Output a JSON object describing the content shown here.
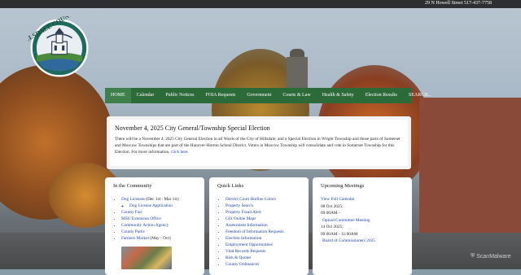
{
  "topbar": {
    "address": "29 N Howell Street 517-437-7758"
  },
  "logo": {
    "text": "HILLSDALE COUNTY"
  },
  "nav": {
    "items": [
      "HOME",
      "Calendar",
      "Public Notices",
      "FOIA Requests",
      "Government",
      "Courts & Law",
      "Health & Safety",
      "Election Results",
      "SEARCH..."
    ]
  },
  "notice": {
    "title": "November 4, 2025 City General/Township Special Election",
    "body": "There will be a November 4, 2025 City General Election in all Wards of the City of Hillsdale; and a Special Election in Wright Township and those parts of Somerset and Moscow Townships that are part of the Hanover-Horton School District. Voters in Moscow Township will consolidate and vote in Somerset Township for this Election. For more information,",
    "link": "click here."
  },
  "community": {
    "title": "In the Community",
    "items": [
      {
        "link": "Dog Licenses",
        "extra": " (Dec 1st - Mar 1st)"
      },
      {
        "link": "County Fair",
        "extra": ""
      },
      {
        "link": "MSU Extension Office",
        "extra": ""
      },
      {
        "link": "Community Action Agency",
        "extra": ""
      },
      {
        "link": "County Parks",
        "extra": ""
      },
      {
        "link": "Farmers Market",
        "extra": " (May - Oct)"
      }
    ],
    "sub_item": "Dog License Application"
  },
  "quick_links": {
    "title": "Quick Links",
    "items": [
      "District Court Hotline Colors",
      "Property Search",
      "Property Fraud Alert",
      "GIS Online Maps",
      "Assessment Information",
      "Freedom of Information Requests",
      "Election Information",
      "Employment Opportunities",
      "Vital Records Requests",
      "Bids & Quotes",
      "County Ordinances"
    ]
  },
  "meetings": {
    "title": "Upcoming Meetings",
    "calendar_link": "View Full Calendar",
    "entries": [
      {
        "date": "08 Oct 2025;",
        "time": "09:00AM -",
        "name": "Opioid Committee Meeting"
      },
      {
        "date": "14 Oct 2025;",
        "time": "09:00AM - 11:00AM",
        "name": "Board of Commissioners 2025"
      }
    ]
  },
  "watermark": {
    "text": "ScanMalware"
  },
  "colors": {
    "nav": "#2d6a3a",
    "link": "#1a3fa8"
  }
}
